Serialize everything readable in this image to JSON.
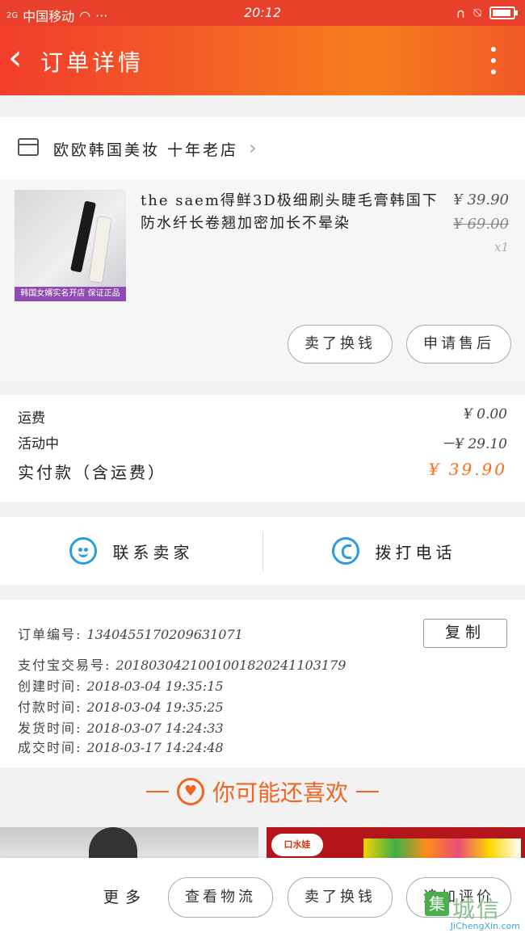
{
  "status_bar": {
    "network": "2G",
    "carrier": "中国移动",
    "dots": "···",
    "time": "20:12"
  },
  "header": {
    "title": "订单详情"
  },
  "shop": {
    "name": "欧欧韩国美妆 十年老店"
  },
  "item": {
    "thumb_tag": "韩国女婿实名开店 保证正品",
    "name": "the saem得鲜3D极细刷头睫毛膏韩国下防水纤长卷翘加密加长不晕染",
    "price": "¥ 39.90",
    "original_price": "¥ 69.00",
    "quantity": "x1",
    "btn_sell": "卖了换钱",
    "btn_aftersale": "申请售后"
  },
  "fees": {
    "shipping_label": "运费",
    "shipping_value": "¥ 0.00",
    "promo_label": "活动中",
    "promo_value": "－¥ 29.10",
    "total_label": "实付款（含运费）",
    "total_value": "¥ 39.90"
  },
  "contact": {
    "seller": "联系卖家",
    "call": "拨打电话"
  },
  "order": {
    "no_label": "订单编号:",
    "no_value": "1340455170209631071",
    "copy": "复制",
    "alipay_label": "支付宝交易号:",
    "alipay_value": "2018030421001001820241103179",
    "created_label": "创建时间:",
    "created_value": "2018-03-04 19:35:15",
    "paid_label": "付款时间:",
    "paid_value": "2018-03-04 19:35:25",
    "shipped_label": "发货时间:",
    "shipped_value": "2018-03-07 14:24:33",
    "done_label": "成交时间:",
    "done_value": "2018-03-17 14:24:48"
  },
  "recommend": {
    "title": "你可能还喜欢",
    "brand_logo": "口水娃"
  },
  "bottom": {
    "more": "更多",
    "logistics": "查看物流",
    "sell": "卖了换钱",
    "review": "追加评价"
  },
  "watermark": {
    "mark": "集",
    "text": "城信",
    "url": "JiChengXin.com"
  },
  "colors": {
    "accent": "#f05a25",
    "price_orange": "#ff6a1a",
    "icon_blue": "#2a9de0"
  }
}
